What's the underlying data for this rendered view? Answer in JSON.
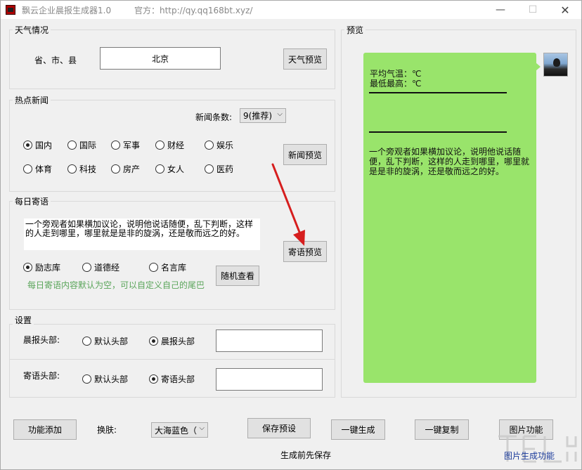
{
  "window": {
    "title": "飘云企业晨报生成器1.0",
    "url_text": "官方：http://qy.qq168bt.xyz/",
    "min": "—",
    "max": "☐",
    "close": "✕"
  },
  "weather": {
    "group_title": "天气情况",
    "location_label": "省、市、县",
    "location_value": "北京",
    "preview_button": "天气预览"
  },
  "news": {
    "group_title": "热点新闻",
    "count_label": "新闻条数:",
    "count_value": "9(推荐)",
    "categories_row1": [
      "国内",
      "国际",
      "军事",
      "财经",
      "娱乐"
    ],
    "categories_row2": [
      "体育",
      "科技",
      "房产",
      "女人",
      "医药"
    ],
    "selected": "国内",
    "preview_button": "新闻预览"
  },
  "daily": {
    "group_title": "每日寄语",
    "text": "一个旁观者如果横加议论，说明他说话随便，乱下判断，这样的人走到哪里，哪里就是是非的旋涡，还是敬而远之的好。",
    "preview_button": "寄语预览",
    "sources": [
      "励志库",
      "道德经",
      "名言库"
    ],
    "selected_source": "励志库",
    "random_button": "随机查看",
    "hint": "每日寄语内容默认为空，可以自定义自己的尾巴"
  },
  "settings": {
    "group_title": "设置",
    "morning_header_label": "晨报头部:",
    "morning_options": [
      "默认头部",
      "晨报头部"
    ],
    "morning_selected": "晨报头部",
    "greeting_header_label": "寄语头部:",
    "greeting_options": [
      "默认头部",
      "寄语头部"
    ],
    "greeting_selected": "寄语头部"
  },
  "preview": {
    "group_title": "预览",
    "avg_temp": "平均气温：℃",
    "min_temp": "最低最高：℃",
    "quote": "一个旁观者如果横加议论，说明他说话随便，乱下判断，这样的人走到哪里，哪里就是是非的旋涡，还是敬而远之的好。"
  },
  "bottom": {
    "add_button": "功能添加",
    "skin_label": "换肤:",
    "skin_value": "大海蓝色（",
    "save_button": "保存预设",
    "generate_button": "一键生成",
    "copy_button": "一键复制",
    "image_button": "图片功能",
    "footer_note": "生成前先保存",
    "watermark_sub": "图片生成功能"
  },
  "colors": {
    "bubble": "#99e46b",
    "hint": "#5aa55a",
    "arrow": "#d61e1e"
  }
}
